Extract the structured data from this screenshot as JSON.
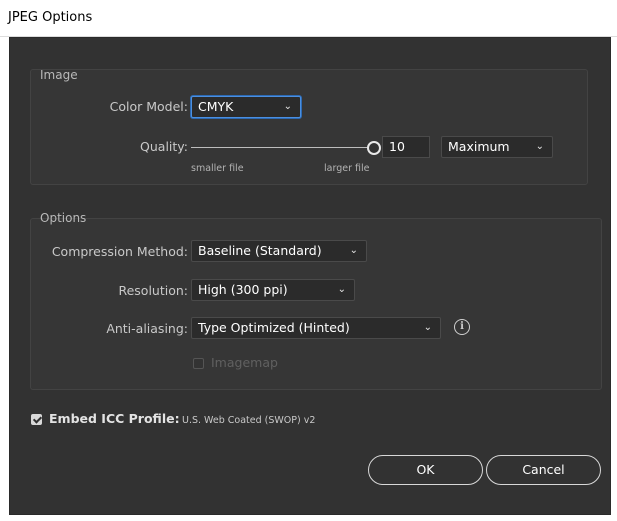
{
  "window": {
    "title": "JPEG Options"
  },
  "image_group": {
    "title": "Image",
    "color_model": {
      "label": "Color Model:",
      "value": "CMYK"
    },
    "quality": {
      "label": "Quality:",
      "value": "10",
      "preset": "Maximum",
      "min_caption": "smaller file",
      "max_caption": "larger file",
      "slider_fraction": 1.0
    }
  },
  "options_group": {
    "title": "Options",
    "compression": {
      "label": "Compression Method:",
      "value": "Baseline (Standard)"
    },
    "resolution": {
      "label": "Resolution:",
      "value": "High (300 ppi)"
    },
    "anti_aliasing": {
      "label": "Anti-aliasing:",
      "value": "Type Optimized (Hinted)"
    },
    "imagemap": {
      "label": "Imagemap",
      "checked": false,
      "enabled": false
    }
  },
  "icc": {
    "label": "Embed ICC Profile:",
    "value": "U.S. Web Coated (SWOP) v2",
    "checked": true
  },
  "buttons": {
    "ok": "OK",
    "cancel": "Cancel"
  },
  "icons": {
    "dropdown": "chevron-down-icon",
    "info": "info-icon",
    "check": "checkmark-icon"
  },
  "colors": {
    "dialog_bg": "#323232",
    "focus": "#4b8fe0",
    "text": "#c9c9c9"
  }
}
